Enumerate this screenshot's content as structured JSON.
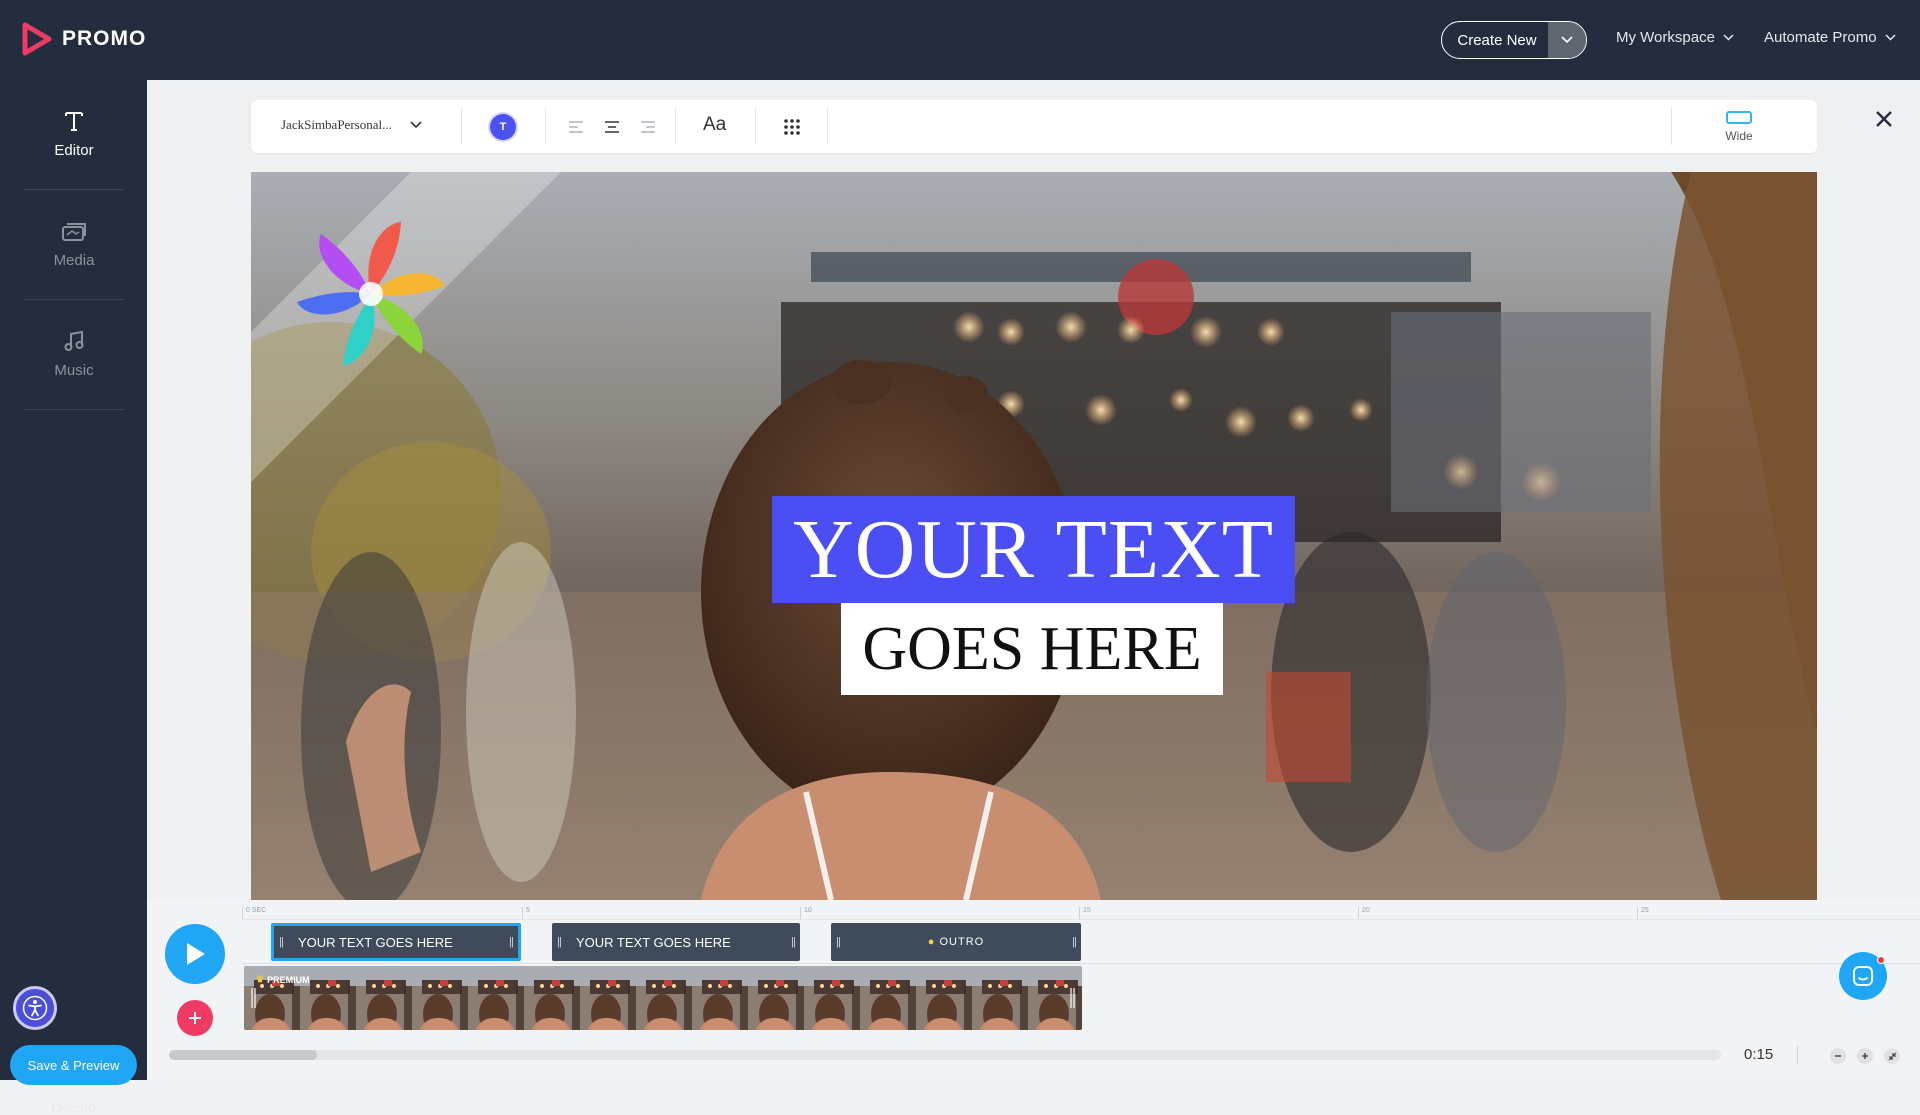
{
  "app": {
    "name": "PROMO"
  },
  "header": {
    "create_new": "Create New",
    "workspace": "My Workspace",
    "automate": "Automate Promo"
  },
  "sidebar": {
    "items": [
      {
        "label": "Editor",
        "icon": "text-t-icon"
      },
      {
        "label": "Media",
        "icon": "media-stack-icon"
      },
      {
        "label": "Music",
        "icon": "music-note-icon"
      }
    ],
    "save_preview": "Save & Preview",
    "discard": "Discard"
  },
  "toolbar": {
    "font_name": "JackSimbaPersonal...",
    "text_color_label": "T",
    "text_color": "#4b52f2",
    "case_label": "Aa",
    "aspect_label": "Wide"
  },
  "preview": {
    "line1": "YOUR TEXT",
    "line2": "GOES HERE",
    "highlight_color": "#4b4ff3"
  },
  "timeline": {
    "ruler": [
      "0 SEC",
      "5",
      "10",
      "15",
      "20",
      "25"
    ],
    "clips": [
      {
        "label": "YOUR TEXT GOES HERE",
        "selected": true
      },
      {
        "label": "YOUR TEXT GOES HERE",
        "selected": false
      },
      {
        "label": "OUTRO",
        "selected": false
      }
    ],
    "premium_badge": "PREMIUM",
    "duration": "0:15"
  },
  "colors": {
    "brand": "#ef3a64",
    "accent": "#1fa6f5",
    "nav_bg": "#232d3d"
  }
}
